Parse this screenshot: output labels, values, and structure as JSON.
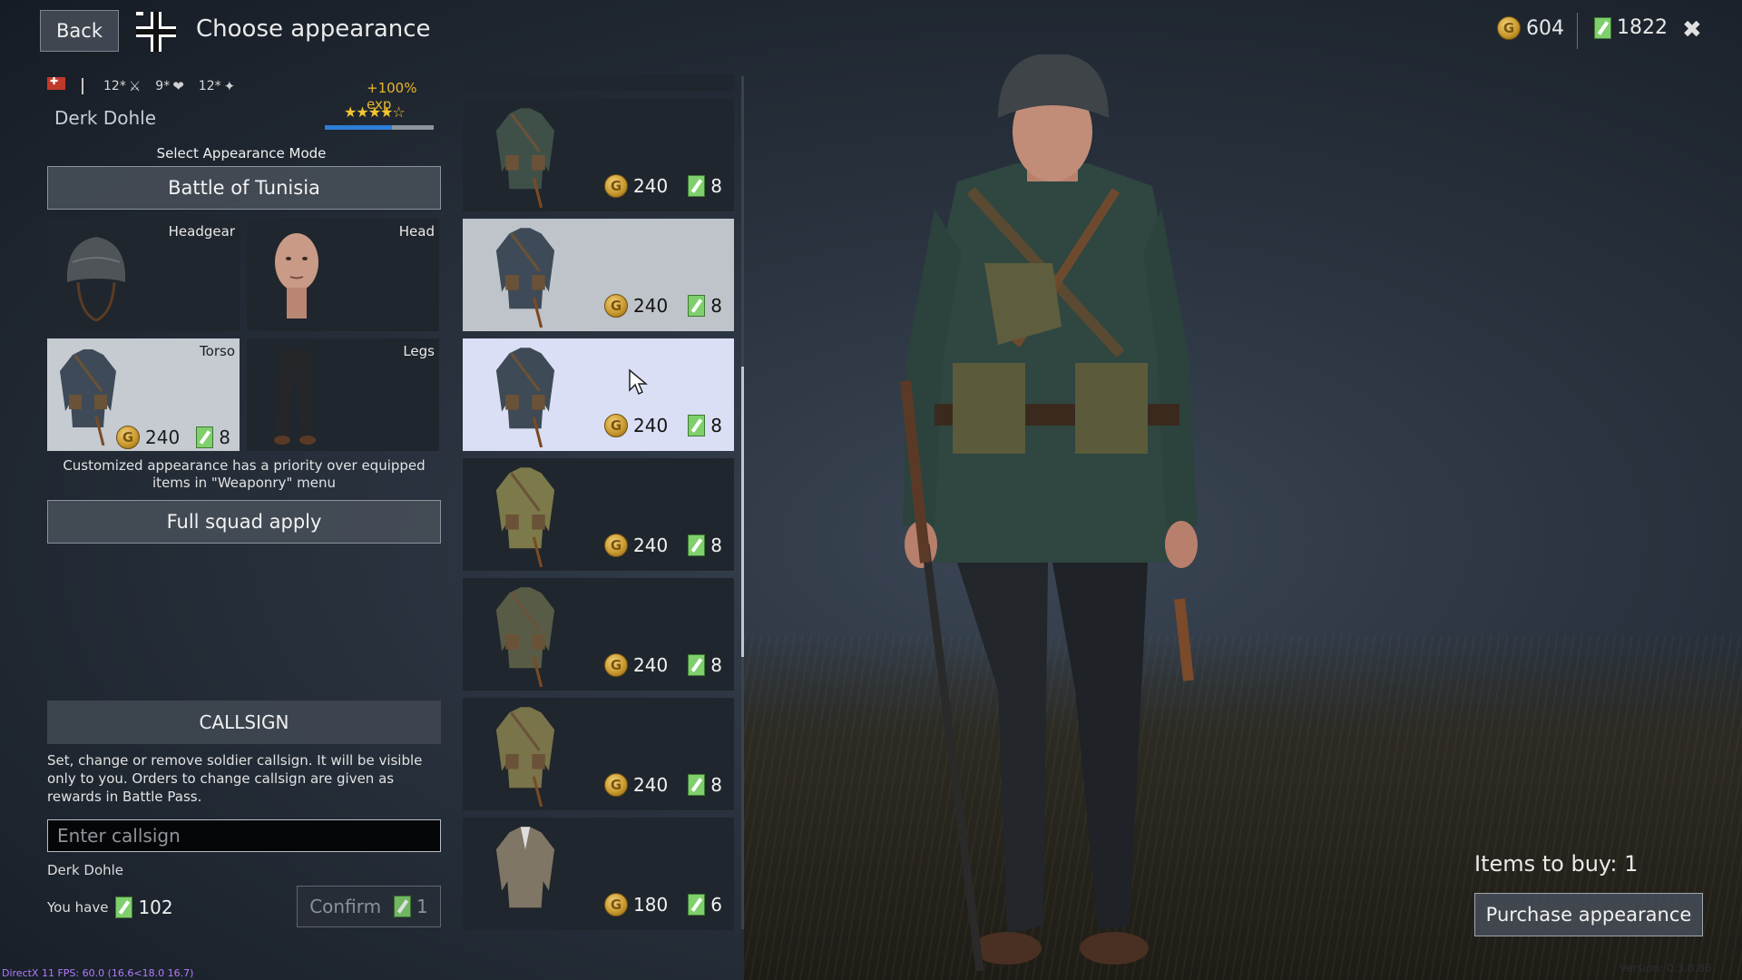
{
  "topbar": {
    "back_label": "Back",
    "title": "Choose appearance",
    "gold": "604",
    "tickets": "1822",
    "close_glyph": "✖"
  },
  "soldier": {
    "stats": [
      {
        "value": "12",
        "icon": "strength-icon",
        "glyph": "⚔"
      },
      {
        "value": "9",
        "icon": "health-icon",
        "glyph": "❤"
      },
      {
        "value": "12",
        "icon": "skill-icon",
        "glyph": "✦"
      }
    ],
    "exp_bonus": "+100% exp",
    "name": "Derk Dohle",
    "rating": 4,
    "rating_stars": "★★★★☆",
    "progress": 0.62
  },
  "appearance": {
    "mode_label": "Select Appearance Mode",
    "mode_value": "Battle of Tunisia",
    "slots": {
      "headgear": "Headgear",
      "head": "Head",
      "torso": "Torso",
      "legs": "Legs"
    },
    "torso_price": {
      "gold": "240",
      "tickets": "8"
    },
    "note": "Customized appearance has a priority over equipped items in \"Weaponry\" menu",
    "squad_btn": "Full squad apply"
  },
  "callsign": {
    "header": "CALLSIGN",
    "description": "Set, change or remove soldier callsign. It will be visible only to you. Orders to change callsign are given as rewards in Battle Pass.",
    "placeholder": "Enter callsign",
    "current": "Derk Dohle",
    "you_have_label": "You have",
    "you_have_value": "102",
    "confirm_label": "Confirm",
    "confirm_cost": "1"
  },
  "items": [
    {
      "gold": "240",
      "tickets": "8",
      "tunic": "#3f5049"
    },
    {
      "gold": "240",
      "tickets": "8",
      "tunic": "#3e4a57"
    },
    {
      "gold": "240",
      "tickets": "8",
      "tunic": "#3e4a55"
    },
    {
      "gold": "240",
      "tickets": "8",
      "tunic": "#7c7a4a"
    },
    {
      "gold": "240",
      "tickets": "8",
      "tunic": "#585c46"
    },
    {
      "gold": "240",
      "tickets": "8",
      "tunic": "#7a744b"
    },
    {
      "gold": "180",
      "tickets": "6",
      "tunic": "#807665"
    }
  ],
  "purchase": {
    "items_to_buy": "Items to buy: 1",
    "button": "Purchase appearance"
  },
  "debug": {
    "fps": "DirectX 11 FPS: 60.0 (16.6<18.0 16.7)",
    "version": "Version: 0.3.8.86"
  },
  "colors": {
    "background": "#2a333f",
    "panel": "#20262d",
    "hover_card": "#bfc4cb",
    "selected_card": "#dadff5",
    "exp_text": "#e8b62c",
    "ticket_green": "#7fcf6c",
    "gold_coin": "#c99a2e"
  }
}
